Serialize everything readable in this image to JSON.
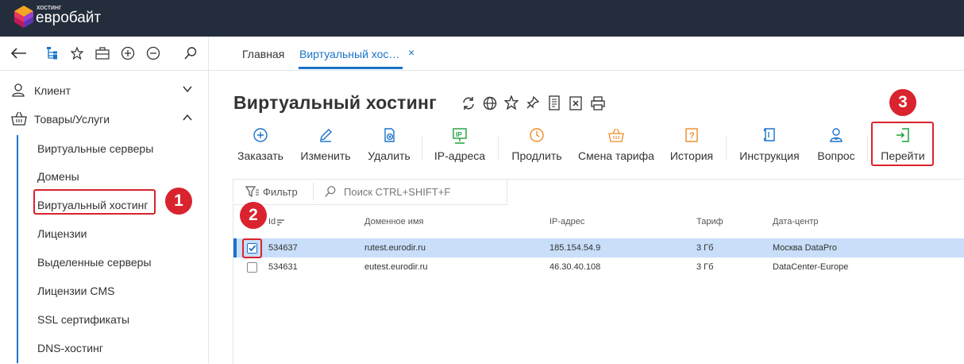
{
  "app": {
    "logo_small": "хостинг",
    "logo_big": "евробайт"
  },
  "toolbar": {
    "icons": [
      "back-arrow-icon",
      "tree-icon",
      "star-icon",
      "briefcase-icon",
      "plus-circle-icon",
      "minus-circle-icon",
      "search-icon"
    ]
  },
  "tabs": [
    {
      "label": "Главная",
      "active": false
    },
    {
      "label": "Виртуальный хос…",
      "active": true
    }
  ],
  "tab_close": "×",
  "sidebar": {
    "groups": [
      {
        "label": "Клиент",
        "icon": "user-icon",
        "expanded": false
      },
      {
        "label": "Товары/Услуги",
        "icon": "basket-icon",
        "expanded": true
      }
    ],
    "items": [
      {
        "label": "Виртуальные серверы"
      },
      {
        "label": "Домены"
      },
      {
        "label": "Виртуальный хостинг",
        "active": true
      },
      {
        "label": "Лицензии"
      },
      {
        "label": "Выделенные серверы"
      },
      {
        "label": "Лицензии CMS"
      },
      {
        "label": "SSL сертификаты"
      },
      {
        "label": "DNS-хостинг"
      }
    ]
  },
  "page": {
    "title": "Виртуальный хостинг",
    "title_icons": [
      "refresh-icon",
      "globe-icon",
      "star-icon",
      "pin-icon",
      "document-icon",
      "export-icon",
      "print-icon"
    ]
  },
  "actions": [
    {
      "label": "Заказать",
      "icon": "plus-circle-icon"
    },
    {
      "label": "Изменить",
      "icon": "pencil-icon"
    },
    {
      "label": "Удалить",
      "icon": "delete-icon"
    },
    {
      "label": "IP-адреса",
      "icon": "ip-icon"
    },
    {
      "label": "Продлить",
      "icon": "clock-icon"
    },
    {
      "label": "Смена тарифа",
      "icon": "basket-icon"
    },
    {
      "label": "История",
      "icon": "history-icon"
    },
    {
      "label": "Инструкция",
      "icon": "manual-icon"
    },
    {
      "label": "Вопрос",
      "icon": "support-icon"
    },
    {
      "label": "Перейти",
      "icon": "enter-icon"
    }
  ],
  "filter": {
    "label": "Фильтр",
    "search_placeholder": "Поиск CTRL+SHIFT+F"
  },
  "table": {
    "columns": [
      "Id",
      "Доменное имя",
      "IP-адрес",
      "Тариф",
      "Дата-центр"
    ],
    "rows": [
      {
        "id": "534637",
        "domain": "rutest.eurodir.ru",
        "ip": "185.154.54.9",
        "tariff": "3 Гб",
        "dc": "Москва DataPro",
        "selected": true
      },
      {
        "id": "534631",
        "domain": "eutest.eurodir.ru",
        "ip": "46.30.40.108",
        "tariff": "3 Гб",
        "dc": "DataCenter-Europe",
        "selected": false
      }
    ]
  },
  "annotations": [
    "1",
    "2",
    "3"
  ],
  "colors": {
    "accent": "#1a73c8",
    "highlight": "#d9232e",
    "topbar": "#242d3b",
    "selected_row": "#c9def9",
    "icon_green": "#1aa33a",
    "icon_orange": "#f08a24"
  }
}
